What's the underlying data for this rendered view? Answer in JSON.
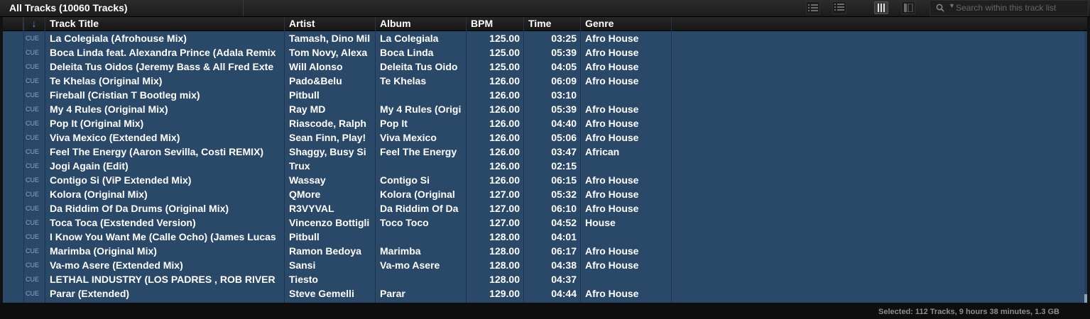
{
  "header": {
    "view_title": "All Tracks (10060 Tracks)",
    "search_placeholder": "Search within this track list",
    "view_buttons": [
      {
        "icon": "list-detailed-icon",
        "active": false
      },
      {
        "icon": "list-compact-icon",
        "active": false
      },
      {
        "icon": "columns-icon",
        "active": true
      },
      {
        "icon": "split-view-icon",
        "active": false
      }
    ]
  },
  "columns": {
    "sort_indicator": "↓",
    "track_title": "Track Title",
    "artist": "Artist",
    "album": "Album",
    "bpm": "BPM",
    "time": "Time",
    "genre": "Genre"
  },
  "cue_label": "CUE",
  "rows": [
    {
      "title": "La Colegiala  (Afrohouse Mix)",
      "artist": "Tamash, Dino Mil",
      "album": "La Colegiala",
      "bpm": "125.00",
      "time": "03:25",
      "genre": "Afro House"
    },
    {
      "title": "Boca Linda feat. Alexandra Prince (Adala Remix",
      "artist": "Tom Novy, Alexa",
      "album": "Boca Linda",
      "bpm": "125.00",
      "time": "05:39",
      "genre": "Afro House"
    },
    {
      "title": "Deleita Tus Oidos (Jeremy Bass & All Fred Exte",
      "artist": "Will Alonso",
      "album": "Deleita Tus Oido",
      "bpm": "125.00",
      "time": "04:05",
      "genre": "Afro House"
    },
    {
      "title": "Te Khelas (Original Mix)",
      "artist": "Pado&Belu",
      "album": "Te Khelas",
      "bpm": "126.00",
      "time": "06:09",
      "genre": "Afro House"
    },
    {
      "title": "Fireball (Cristian T Bootleg mix)",
      "artist": "Pitbull",
      "album": "",
      "bpm": "126.00",
      "time": "03:10",
      "genre": ""
    },
    {
      "title": "My 4 Rules (Original Mix)",
      "artist": "Ray MD",
      "album": "My 4 Rules (Origi",
      "bpm": "126.00",
      "time": "05:39",
      "genre": "Afro House"
    },
    {
      "title": "Pop It (Original Mix)",
      "artist": "Riascode, Ralph",
      "album": "Pop It",
      "bpm": "126.00",
      "time": "04:40",
      "genre": "Afro House"
    },
    {
      "title": "Viva Mexico (Extended Mix)",
      "artist": "Sean Finn, Play!",
      "album": "Viva Mexico",
      "bpm": "126.00",
      "time": "05:06",
      "genre": "Afro House"
    },
    {
      "title": "Feel The Energy (Aaron Sevilla, Costi REMIX)",
      "artist": "Shaggy, Busy Si",
      "album": "Feel The Energy",
      "bpm": "126.00",
      "time": "03:47",
      "genre": "African"
    },
    {
      "title": "Jogi Again (Edit)",
      "artist": "Trux",
      "album": "",
      "bpm": "126.00",
      "time": "02:15",
      "genre": ""
    },
    {
      "title": "Contigo Si (ViP Extended Mix)",
      "artist": "Wassay",
      "album": "Contigo Si",
      "bpm": "126.00",
      "time": "06:15",
      "genre": "Afro House"
    },
    {
      "title": "Kolora  (Original Mix)",
      "artist": "QMore",
      "album": "Kolora (Original",
      "bpm": "127.00",
      "time": "05:32",
      "genre": "Afro House"
    },
    {
      "title": "Da Riddim Of Da Drums (Original Mix)",
      "artist": "R3VYVAL",
      "album": "Da Riddim Of Da",
      "bpm": "127.00",
      "time": "06:10",
      "genre": "Afro House"
    },
    {
      "title": "Toca Toca (Exstended Version)",
      "artist": "Vincenzo Bottigli",
      "album": "Toco Toco",
      "bpm": "127.00",
      "time": "04:52",
      "genre": "House"
    },
    {
      "title": "I Know You Want Me (Calle Ocho) (James Lucas",
      "artist": "Pitbull",
      "album": "",
      "bpm": "128.00",
      "time": "04:01",
      "genre": ""
    },
    {
      "title": "Marimba (Original Mix)",
      "artist": "Ramon Bedoya",
      "album": "Marimba",
      "bpm": "128.00",
      "time": "06:17",
      "genre": "Afro House"
    },
    {
      "title": "Va-mo Asere (Extended Mix)",
      "artist": "Sansi",
      "album": "Va-mo Asere",
      "bpm": "128.00",
      "time": "04:38",
      "genre": "Afro House"
    },
    {
      "title": "LETHAL INDUSTRY (LOS PADRES , ROB RIVER",
      "artist": "Tiesto",
      "album": "",
      "bpm": "128.00",
      "time": "04:37",
      "genre": ""
    },
    {
      "title": "Parar (Extended)",
      "artist": "Steve Gemelli",
      "album": "Parar",
      "bpm": "129.00",
      "time": "04:44",
      "genre": "Afro House"
    }
  ],
  "status": {
    "text": "Selected: 112 Tracks, 9 hours 38 minutes, 1.3 GB"
  },
  "colors": {
    "selection_bg": "#2a4868",
    "accent": "#4a8fe0"
  }
}
